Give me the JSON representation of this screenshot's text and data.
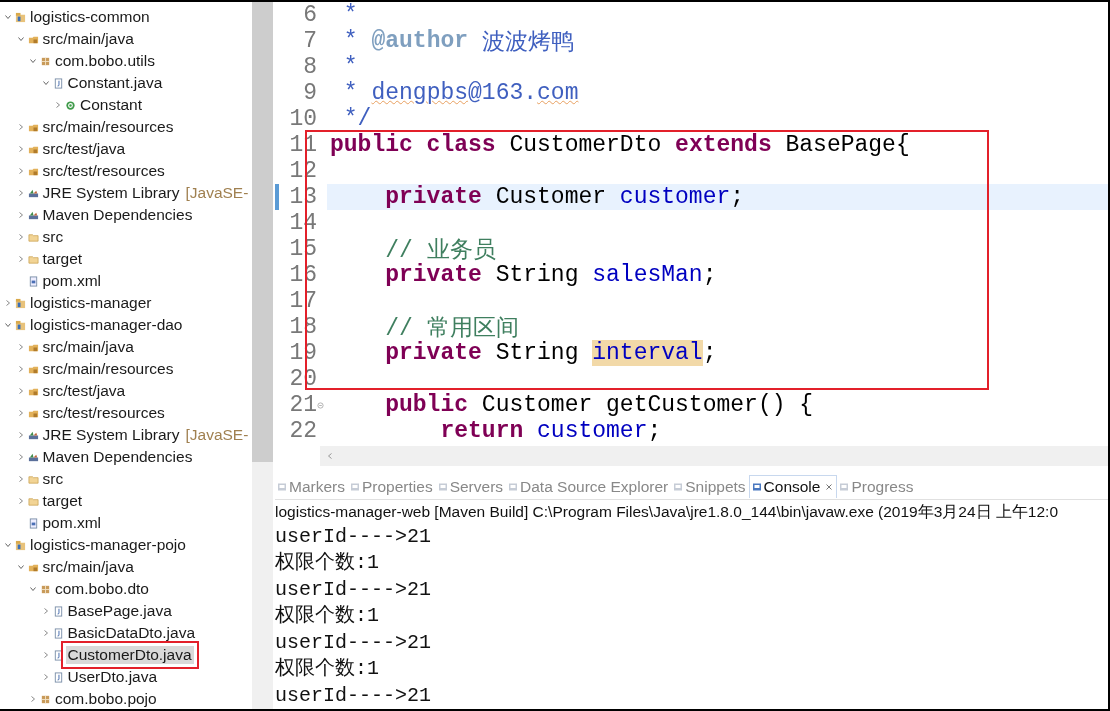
{
  "project_explorer": {
    "tree": [
      {
        "label": "logistics-common",
        "kind": "project",
        "expanded": true,
        "selected": false,
        "framed": false,
        "children": [
          {
            "label": "src/main/java",
            "kind": "srcfolder",
            "expanded": true,
            "selected": false,
            "framed": false,
            "children": [
              {
                "label": "com.bobo.utils",
                "kind": "package",
                "expanded": true,
                "selected": false,
                "framed": false,
                "children": [
                  {
                    "label": "Constant.java",
                    "kind": "java",
                    "expanded": true,
                    "selected": false,
                    "framed": false,
                    "children": [
                      {
                        "label": "Constant",
                        "kind": "class",
                        "expanded": false,
                        "selected": false,
                        "framed": false
                      }
                    ]
                  }
                ]
              }
            ]
          },
          {
            "label": "src/main/resources",
            "kind": "srcfolder",
            "expanded": false,
            "selected": false,
            "framed": false
          },
          {
            "label": "src/test/java",
            "kind": "srcfolder",
            "expanded": false,
            "selected": false,
            "framed": false
          },
          {
            "label": "src/test/resources",
            "kind": "srcfolder",
            "expanded": false,
            "selected": false,
            "framed": false
          },
          {
            "label": "JRE System Library",
            "decoration": "[JavaSE-",
            "kind": "library",
            "expanded": false,
            "selected": false,
            "framed": false
          },
          {
            "label": "Maven Dependencies",
            "kind": "library",
            "expanded": false,
            "selected": false,
            "framed": false
          },
          {
            "label": "src",
            "kind": "folder",
            "expanded": false,
            "selected": false,
            "framed": false
          },
          {
            "label": "target",
            "kind": "folder",
            "expanded": false,
            "selected": false,
            "framed": false
          },
          {
            "label": "pom.xml",
            "kind": "file",
            "selected": false,
            "framed": false
          }
        ]
      },
      {
        "label": "logistics-manager",
        "kind": "project",
        "expanded": false,
        "selected": false,
        "framed": false
      },
      {
        "label": "logistics-manager-dao",
        "kind": "project",
        "expanded": true,
        "selected": false,
        "framed": false,
        "children": [
          {
            "label": "src/main/java",
            "kind": "srcfolder",
            "expanded": false,
            "selected": false,
            "framed": false
          },
          {
            "label": "src/main/resources",
            "kind": "srcfolder",
            "expanded": false,
            "selected": false,
            "framed": false
          },
          {
            "label": "src/test/java",
            "kind": "srcfolder",
            "expanded": false,
            "selected": false,
            "framed": false
          },
          {
            "label": "src/test/resources",
            "kind": "srcfolder",
            "expanded": false,
            "selected": false,
            "framed": false
          },
          {
            "label": "JRE System Library",
            "decoration": "[JavaSE-",
            "kind": "library",
            "expanded": false,
            "selected": false,
            "framed": false
          },
          {
            "label": "Maven Dependencies",
            "kind": "library",
            "expanded": false,
            "selected": false,
            "framed": false
          },
          {
            "label": "src",
            "kind": "folder",
            "expanded": false,
            "selected": false,
            "framed": false
          },
          {
            "label": "target",
            "kind": "folder",
            "expanded": false,
            "selected": false,
            "framed": false
          },
          {
            "label": "pom.xml",
            "kind": "file",
            "selected": false,
            "framed": false
          }
        ]
      },
      {
        "label": "logistics-manager-pojo",
        "kind": "project",
        "expanded": true,
        "selected": false,
        "framed": false,
        "children": [
          {
            "label": "src/main/java",
            "kind": "srcfolder",
            "expanded": true,
            "selected": false,
            "framed": false,
            "children": [
              {
                "label": "com.bobo.dto",
                "kind": "package",
                "expanded": true,
                "selected": false,
                "framed": false,
                "children": [
                  {
                    "label": "BasePage.java",
                    "kind": "java",
                    "expanded": false,
                    "selected": false,
                    "framed": false
                  },
                  {
                    "label": "BasicDataDto.java",
                    "kind": "java",
                    "expanded": false,
                    "selected": false,
                    "framed": false
                  },
                  {
                    "label": "CustomerDto.java",
                    "kind": "java",
                    "expanded": false,
                    "selected": true,
                    "framed": true
                  },
                  {
                    "label": "UserDto.java",
                    "kind": "java",
                    "expanded": false,
                    "selected": false,
                    "framed": false
                  }
                ]
              },
              {
                "label": "com.bobo.pojo",
                "kind": "package",
                "expanded": false,
                "selected": false,
                "framed": false
              }
            ]
          }
        ]
      }
    ]
  },
  "editor": {
    "lines": [
      {
        "number": "6",
        "current": false,
        "framed": false,
        "tokens": [
          {
            "kind": "javadoc",
            "text": " *"
          }
        ]
      },
      {
        "number": "7",
        "current": false,
        "framed": false,
        "tokens": [
          {
            "kind": "javadoc",
            "text": " * "
          },
          {
            "kind": "javadoc-tag",
            "text": "@author"
          },
          {
            "kind": "javadoc",
            "text": " 波波烤鸭"
          }
        ]
      },
      {
        "number": "8",
        "current": false,
        "framed": false,
        "tokens": [
          {
            "kind": "javadoc",
            "text": " *"
          }
        ]
      },
      {
        "number": "9",
        "current": false,
        "framed": false,
        "tokens": [
          {
            "kind": "javadoc",
            "text": " * "
          },
          {
            "kind": "javadoc",
            "text": "dengpbs",
            "misspelled": true
          },
          {
            "kind": "javadoc",
            "text": "@163."
          },
          {
            "kind": "javadoc",
            "text": "com",
            "misspelled": true
          }
        ]
      },
      {
        "number": "10",
        "current": false,
        "framed": false,
        "tokens": [
          {
            "kind": "javadoc",
            "text": " */"
          }
        ]
      },
      {
        "number": "11",
        "current": false,
        "framed": true,
        "tokens": [
          {
            "kind": "keyword",
            "text": "public class"
          },
          {
            "kind": "plain",
            "text": " CustomerDto "
          },
          {
            "kind": "keyword",
            "text": "extends"
          },
          {
            "kind": "plain",
            "text": " BasePage{"
          }
        ]
      },
      {
        "number": "12",
        "current": false,
        "framed": true
      },
      {
        "number": "13",
        "current": true,
        "framed": true,
        "tokens": [
          {
            "kind": "keyword",
            "text": "    private"
          },
          {
            "kind": "plain",
            "text": " Customer "
          },
          {
            "kind": "field",
            "text": "customer"
          },
          {
            "kind": "plain",
            "text": ";"
          }
        ]
      },
      {
        "number": "14",
        "current": false,
        "framed": true
      },
      {
        "number": "15",
        "current": false,
        "framed": true,
        "tokens": [
          {
            "kind": "comment",
            "text": "    // 业务员"
          }
        ]
      },
      {
        "number": "16",
        "current": false,
        "framed": true,
        "tokens": [
          {
            "kind": "keyword",
            "text": "    private"
          },
          {
            "kind": "plain",
            "text": " String "
          },
          {
            "kind": "field",
            "text": "salesMan"
          },
          {
            "kind": "plain",
            "text": ";"
          }
        ]
      },
      {
        "number": "17",
        "current": false,
        "framed": true
      },
      {
        "number": "18",
        "current": false,
        "framed": true,
        "tokens": [
          {
            "kind": "comment",
            "text": "    // 常用区间"
          }
        ]
      },
      {
        "number": "19",
        "current": false,
        "framed": true,
        "tokens": [
          {
            "kind": "keyword",
            "text": "    private"
          },
          {
            "kind": "plain",
            "text": " String "
          },
          {
            "kind": "field",
            "text": "interval",
            "occurrence": true
          },
          {
            "kind": "plain",
            "text": ";"
          }
        ]
      },
      {
        "number": "20",
        "current": false,
        "framed": true
      },
      {
        "number": "21",
        "current": false,
        "framed": false,
        "foldable": true,
        "tokens": [
          {
            "kind": "keyword",
            "text": "    public"
          },
          {
            "kind": "plain",
            "text": " Customer getCustomer() {"
          }
        ]
      },
      {
        "number": "22",
        "current": false,
        "framed": false,
        "tokens": [
          {
            "kind": "keyword",
            "text": "        return "
          },
          {
            "kind": "field",
            "text": "customer"
          },
          {
            "kind": "plain",
            "text": ";"
          }
        ]
      }
    ]
  },
  "views": {
    "tabs": [
      {
        "label": "Markers",
        "selected": false
      },
      {
        "label": "Properties",
        "selected": false
      },
      {
        "label": "Servers",
        "selected": false
      },
      {
        "label": "Data Source Explorer",
        "selected": false
      },
      {
        "label": "Snippets",
        "selected": false
      },
      {
        "label": "Console",
        "selected": true
      },
      {
        "label": "Progress",
        "selected": false
      }
    ],
    "console": {
      "header": "logistics-manager-web [Maven Build] C:\\Program Files\\Java\\jre1.8.0_144\\bin\\javaw.exe (2019年3月24日 上午12:0",
      "output": [
        "userId---->21",
        "权限个数:1",
        "userId---->21",
        "权限个数:1",
        "userId---->21",
        "权限个数:1",
        "userId---->21"
      ]
    }
  }
}
